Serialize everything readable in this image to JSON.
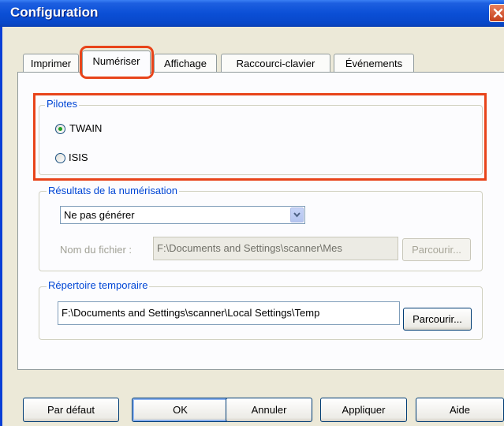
{
  "window": {
    "title": "Configuration"
  },
  "tabs": [
    {
      "label": "Imprimer"
    },
    {
      "label": "Numériser"
    },
    {
      "label": "Affichage"
    },
    {
      "label": "Raccourci-clavier"
    },
    {
      "label": "Événements"
    }
  ],
  "drivers_group": {
    "legend": "Pilotes",
    "options": [
      {
        "label": "TWAIN",
        "selected": true
      },
      {
        "label": "ISIS",
        "selected": false
      }
    ]
  },
  "results_group": {
    "legend": "Résultats de la numérisation",
    "select_value": "Ne pas générer",
    "filename_label": "Nom du fichier :",
    "filename_value": "F:\\Documents and Settings\\scanner\\Mes",
    "browse_label": "Parcourir..."
  },
  "temp_group": {
    "legend": "Répertoire temporaire",
    "path_value": "F:\\Documents and Settings\\scanner\\Local Settings\\Temp",
    "browse_label": "Parcourir..."
  },
  "buttons": {
    "default_label": "Par défaut",
    "ok_label": "OK",
    "cancel_label": "Annuler",
    "apply_label": "Appliquer",
    "help_label": "Aide"
  },
  "colors": {
    "title_bar": "#0b4fd6",
    "group_legend": "#0046d5",
    "highlight": "#e8441a",
    "radio_selected": "#21a121"
  },
  "icons": {
    "close": "close-icon",
    "dropdown": "chevron-down-icon"
  }
}
